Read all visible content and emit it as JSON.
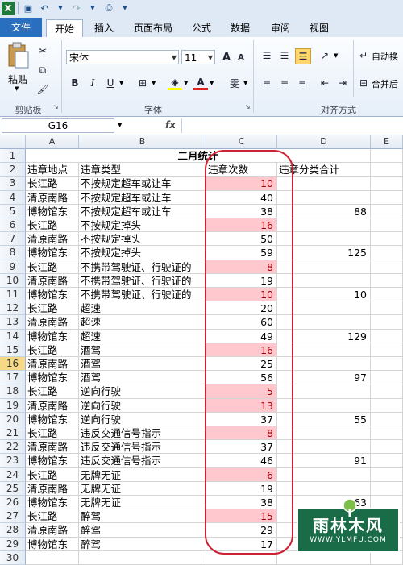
{
  "tabs": [
    "文件",
    "开始",
    "插入",
    "页面布局",
    "公式",
    "数据",
    "审阅",
    "视图"
  ],
  "ribbon": {
    "clipboard_label": "剪贴板",
    "paste_label": "粘贴",
    "font_label": "字体",
    "align_label": "对齐方式",
    "font_name": "宋体",
    "font_size": "11",
    "wrap_text": "自动换",
    "merge_center": "合并后",
    "bold": "B",
    "italic": "I",
    "underline": "U",
    "grow_font": "A",
    "shrink_font": "A",
    "wen": "雯"
  },
  "formula_bar": {
    "name_box": "G16",
    "fx": "fx",
    "content": ""
  },
  "columns": [
    "A",
    "B",
    "C",
    "D",
    "E"
  ],
  "title_cell": "二月统计",
  "headers": [
    "违章地点",
    "违章类型",
    "违章次数",
    "违章分类合计"
  ],
  "rows": [
    {
      "r": "3",
      "a": "长江路",
      "b": "不按规定超车或让车",
      "c": "10",
      "d": "",
      "hl": true
    },
    {
      "r": "4",
      "a": "清原南路",
      "b": "不按规定超车或让车",
      "c": "40",
      "d": "",
      "hl": false
    },
    {
      "r": "5",
      "a": "博物馆东",
      "b": "不按规定超车或让车",
      "c": "38",
      "d": "88",
      "hl": false
    },
    {
      "r": "6",
      "a": "长江路",
      "b": "不按规定掉头",
      "c": "16",
      "d": "",
      "hl": true
    },
    {
      "r": "7",
      "a": "清原南路",
      "b": "不按规定掉头",
      "c": "50",
      "d": "",
      "hl": false
    },
    {
      "r": "8",
      "a": "博物馆东",
      "b": "不按规定掉头",
      "c": "59",
      "d": "125",
      "hl": false
    },
    {
      "r": "9",
      "a": "长江路",
      "b": "不携带驾驶证、行驶证的",
      "c": "8",
      "d": "",
      "hl": true
    },
    {
      "r": "10",
      "a": "清原南路",
      "b": "不携带驾驶证、行驶证的",
      "c": "19",
      "d": "",
      "hl": false
    },
    {
      "r": "11",
      "a": "博物馆东",
      "b": "不携带驾驶证、行驶证的",
      "c": "10",
      "d": "10",
      "hl": true
    },
    {
      "r": "12",
      "a": "长江路",
      "b": "超速",
      "c": "20",
      "d": "",
      "hl": false
    },
    {
      "r": "13",
      "a": "清原南路",
      "b": "超速",
      "c": "60",
      "d": "",
      "hl": false
    },
    {
      "r": "14",
      "a": "博物馆东",
      "b": "超速",
      "c": "49",
      "d": "129",
      "hl": false
    },
    {
      "r": "15",
      "a": "长江路",
      "b": "酒驾",
      "c": "16",
      "d": "",
      "hl": true
    },
    {
      "r": "16",
      "a": "清原南路",
      "b": "酒驾",
      "c": "25",
      "d": "",
      "hl": false
    },
    {
      "r": "17",
      "a": "博物馆东",
      "b": "酒驾",
      "c": "56",
      "d": "97",
      "hl": false
    },
    {
      "r": "18",
      "a": "长江路",
      "b": "逆向行驶",
      "c": "5",
      "d": "",
      "hl": true
    },
    {
      "r": "19",
      "a": "清原南路",
      "b": "逆向行驶",
      "c": "13",
      "d": "",
      "hl": true
    },
    {
      "r": "20",
      "a": "博物馆东",
      "b": "逆向行驶",
      "c": "37",
      "d": "55",
      "hl": false
    },
    {
      "r": "21",
      "a": "长江路",
      "b": "违反交通信号指示",
      "c": "8",
      "d": "",
      "hl": true
    },
    {
      "r": "22",
      "a": "清原南路",
      "b": "违反交通信号指示",
      "c": "37",
      "d": "",
      "hl": false
    },
    {
      "r": "23",
      "a": "博物馆东",
      "b": "违反交通信号指示",
      "c": "46",
      "d": "91",
      "hl": false
    },
    {
      "r": "24",
      "a": "长江路",
      "b": "无牌无证",
      "c": "6",
      "d": "",
      "hl": true
    },
    {
      "r": "25",
      "a": "清原南路",
      "b": "无牌无证",
      "c": "19",
      "d": "",
      "hl": false
    },
    {
      "r": "26",
      "a": "博物馆东",
      "b": "无牌无证",
      "c": "38",
      "d": "63",
      "hl": false
    },
    {
      "r": "27",
      "a": "长江路",
      "b": "醉驾",
      "c": "15",
      "d": "",
      "hl": true
    },
    {
      "r": "28",
      "a": "清原南路",
      "b": "醉驾",
      "c": "29",
      "d": "",
      "hl": false
    },
    {
      "r": "29",
      "a": "博物馆东",
      "b": "醉驾",
      "c": "17",
      "d": "",
      "hl": false
    }
  ],
  "row_30": "30",
  "selected_row": "16",
  "watermark": {
    "big": "雨林木风",
    "small": "WWW.YLMFU.COM"
  },
  "colors": {
    "highlight_fill": "#ffc7ce",
    "highlight_text": "#9c0006",
    "oval": "#cc2233"
  }
}
